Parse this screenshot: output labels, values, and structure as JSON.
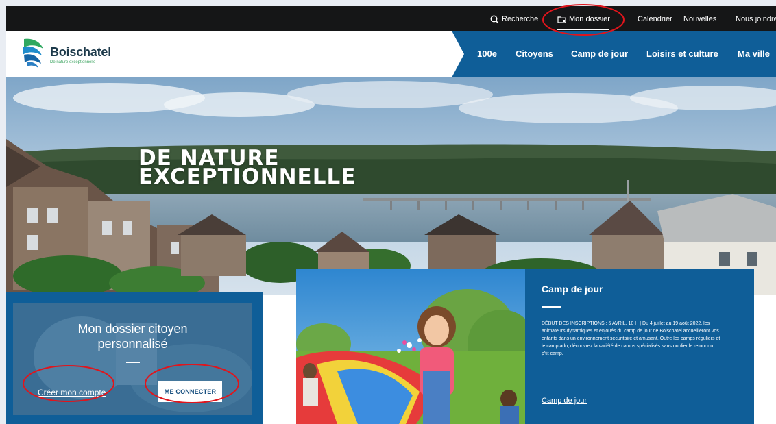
{
  "utility_bar": {
    "search_label": "Recherche",
    "dossier_label": "Mon dossier",
    "calendar_label": "Calendrier",
    "news_label": "Nouvelles",
    "contact_label": "Nous joindre"
  },
  "header": {
    "logo_name": "Boischatel",
    "logo_tagline": "De nature exceptionnelle",
    "nav": [
      "100e",
      "Citoyens",
      "Camp de jour",
      "Loisirs et culture",
      "Ma ville"
    ]
  },
  "hero": {
    "title_line1": "DE NATURE",
    "title_line2": "EXCEPTIONNELLE"
  },
  "citizen_box": {
    "title_line1": "Mon dossier citoyen",
    "title_line2": "personnalisé",
    "create_account_label": "Créer mon compte",
    "connect_label": "ME CONNECTER"
  },
  "camp_card": {
    "title": "Camp de jour",
    "description": "DÉBUT DES INSCRIPTIONS : 5 AVRIL, 10 H | Du 4 juillet au 19 août 2022, les animateurs dynamiques et enjoués du camp de jour de Boischatel accueilleront vos enfants dans un environnement sécuritaire et amusant. Outre les camps réguliers et le camp ado, découvrez la variété de camps spécialisés sans oublier le retour du p'tit camp.",
    "link_label": "Camp de jour"
  },
  "colors": {
    "topbar": "#151617",
    "nav_blue": "#0f5e98",
    "panel_blue": "#0f5e98",
    "annotation_red": "#e0151c"
  },
  "icons": [
    "search-icon",
    "folder-icon"
  ]
}
